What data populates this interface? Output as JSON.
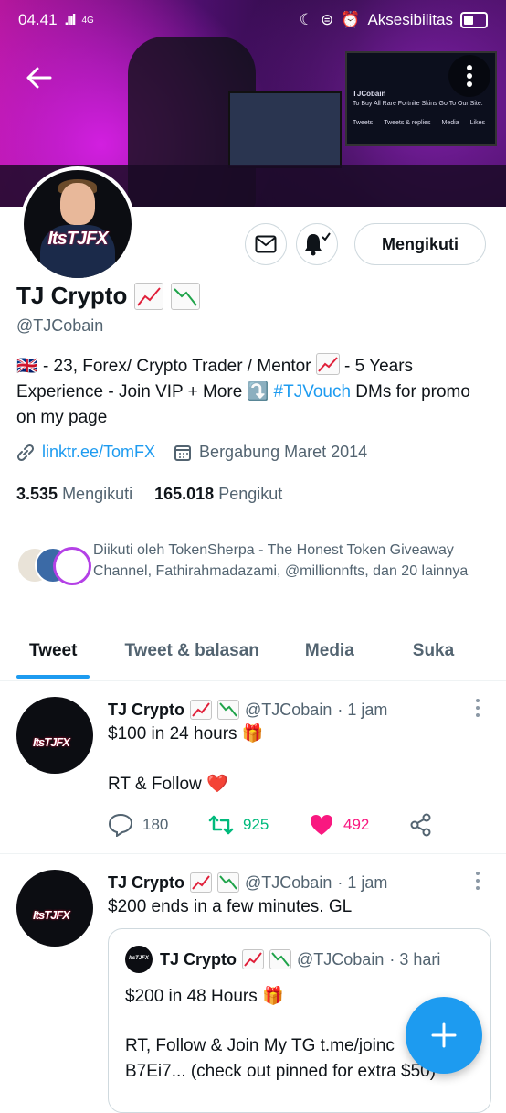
{
  "status": {
    "time": "04.41",
    "signal": ".ııl",
    "network": "4G",
    "accessibility": "Aksesibilitas"
  },
  "profile": {
    "name": "TJ Crypto",
    "handle": "@TJCobain",
    "avatar_logo": "ItsTJFX",
    "follow_label": "Mengikuti",
    "bio": {
      "flag": "🇬🇧",
      "part1": " - 23, Forex/ Crypto Trader / Mentor ",
      "part2": " - 5 Years Experience - Join VIP + More ",
      "arrow": "⤵️",
      "hashtag": "#TJVouch",
      "part3": " DMs for promo on my page"
    },
    "link": "linktr.ee/TomFX",
    "joined": "Bergabung Maret 2014",
    "following_count": "3.535",
    "following_label": "Mengikuti",
    "followers_count": "165.018",
    "followers_label": "Pengikut",
    "followed_by": "Diikuti oleh TokenSherpa - The Honest Token Giveaway Channel, Fathirahmadazami, @millionnfts, dan 20 lainnya"
  },
  "banner_screen": {
    "name": "TJCobain",
    "line": "To Buy All Rare Fortnite Skins Go To Our Site:",
    "tabs": [
      "Tweets",
      "Tweets & replies",
      "Media",
      "Likes"
    ]
  },
  "tabs": [
    "Tweet",
    "Tweet & balasan",
    "Media",
    "Suka"
  ],
  "tweets": [
    {
      "name": "TJ Crypto",
      "handle": "@TJCobain",
      "time": "· 1 jam",
      "line1": "$100 in 24 hours 🎁",
      "line2": "RT & Follow ❤️",
      "replies": "180",
      "retweets": "925",
      "likes": "492"
    },
    {
      "name": "TJ Crypto",
      "handle": "@TJCobain",
      "time": "· 1 jam",
      "line1": "$200 ends in a few minutes. GL",
      "quote": {
        "name": "TJ Crypto",
        "handle": "@TJCobain",
        "time": "· 3 hari",
        "line1": "$200 in 48 Hours 🎁",
        "line2": "RT, Follow & Join My TG t.me/joinc",
        "line3": "B7Ei7... (check out pinned for extra $50)"
      }
    }
  ],
  "colors": {
    "accent": "#1d9bf0",
    "retweet": "#00ba7c",
    "like": "#f91880"
  }
}
